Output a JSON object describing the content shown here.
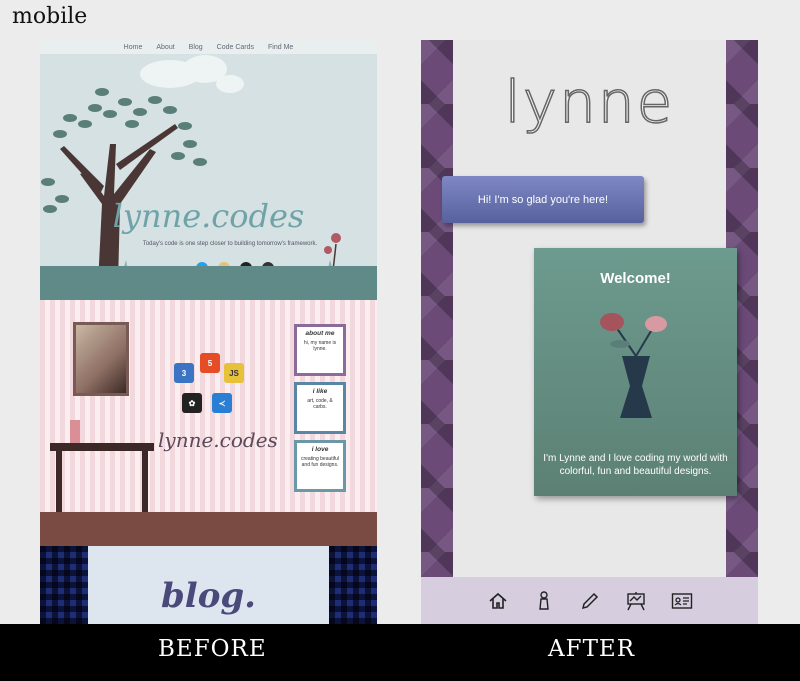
{
  "corner_title": "mobile",
  "before": {
    "nav": [
      "Home",
      "About",
      "Blog",
      "Code Cards",
      "Find Me"
    ],
    "hero_title": "lynne.codes",
    "hero_subtitle": "Today's code is one step closer to building tomorrow's framework.",
    "room_title": "lynne.codes",
    "cards": [
      {
        "heading": "about me",
        "text": "hi, my name is lynne."
      },
      {
        "heading": "i like",
        "text": "art, code, & carbs."
      },
      {
        "heading": "i love",
        "text": "creating beautiful and fun designs."
      }
    ],
    "blog_title": "blog.",
    "logo_badges": [
      "3",
      "5",
      "JS"
    ]
  },
  "after": {
    "title": "lynne",
    "greeting": "Hi! I'm so glad you're here!",
    "welcome_heading": "Welcome!",
    "welcome_text": "I'm Lynne and I love coding my world with colorful, fun and beautiful designs.",
    "tabs": [
      "home-icon",
      "person-icon",
      "pencil-icon",
      "easel-icon",
      "contact-card-icon"
    ]
  },
  "captions": {
    "before": "BEFORE",
    "after": "AFTER"
  },
  "colors": {
    "teal": "#6fa3a8",
    "purple": "#6b4a78",
    "welcome_green": "#6d9b8e",
    "greeting_blue": "#6a74b1"
  }
}
